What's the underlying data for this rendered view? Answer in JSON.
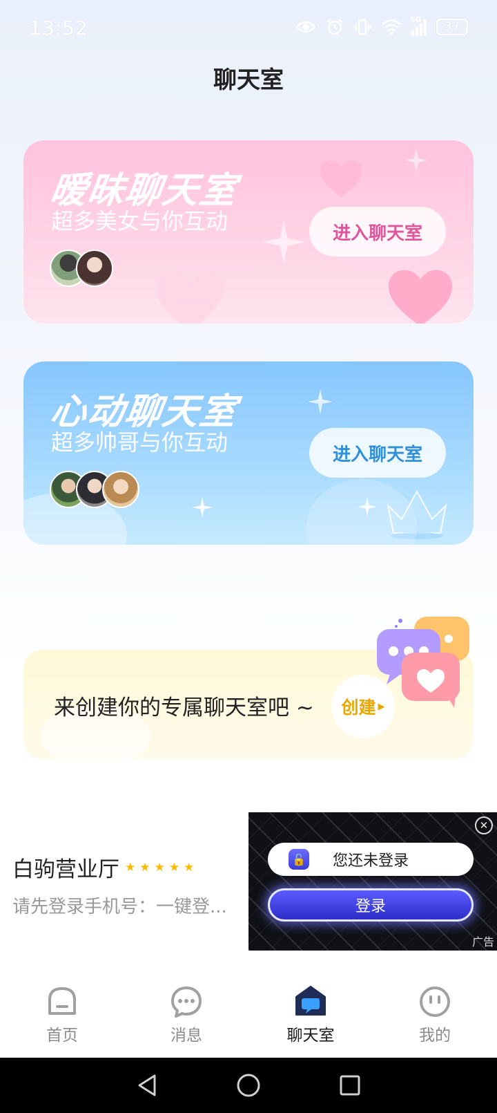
{
  "status_bar": {
    "time": "13:52",
    "battery": "37",
    "network": "5G",
    "icons": [
      "eye-icon",
      "alarm-icon",
      "vibrate-icon",
      "wifi-icon",
      "signal-icon",
      "battery-icon"
    ]
  },
  "page": {
    "title": "聊天室"
  },
  "rooms": [
    {
      "title": "暧昧聊天室",
      "subtitle": "超多美女与你互动",
      "button": "进入聊天室",
      "accent": "#e0569b"
    },
    {
      "title": "心动聊天室",
      "subtitle": "超多帅哥与你互动",
      "button": "进入聊天室",
      "accent": "#2f8fd9"
    }
  ],
  "create_card": {
    "text": "来创建你的专属聊天室吧 ~",
    "button": "创建"
  },
  "ad": {
    "app_name": "白驹营业厅",
    "rating": "★★★★★",
    "description": "请先登录手机号：一键登...",
    "not_logged_in": "您还未登录",
    "login_button": "登录",
    "tag": "广告"
  },
  "bottom_nav": [
    {
      "label": "首页",
      "icon": "home-icon"
    },
    {
      "label": "消息",
      "icon": "message-icon"
    },
    {
      "label": "聊天室",
      "icon": "chatroom-icon",
      "active": true
    },
    {
      "label": "我的",
      "icon": "profile-icon"
    }
  ]
}
